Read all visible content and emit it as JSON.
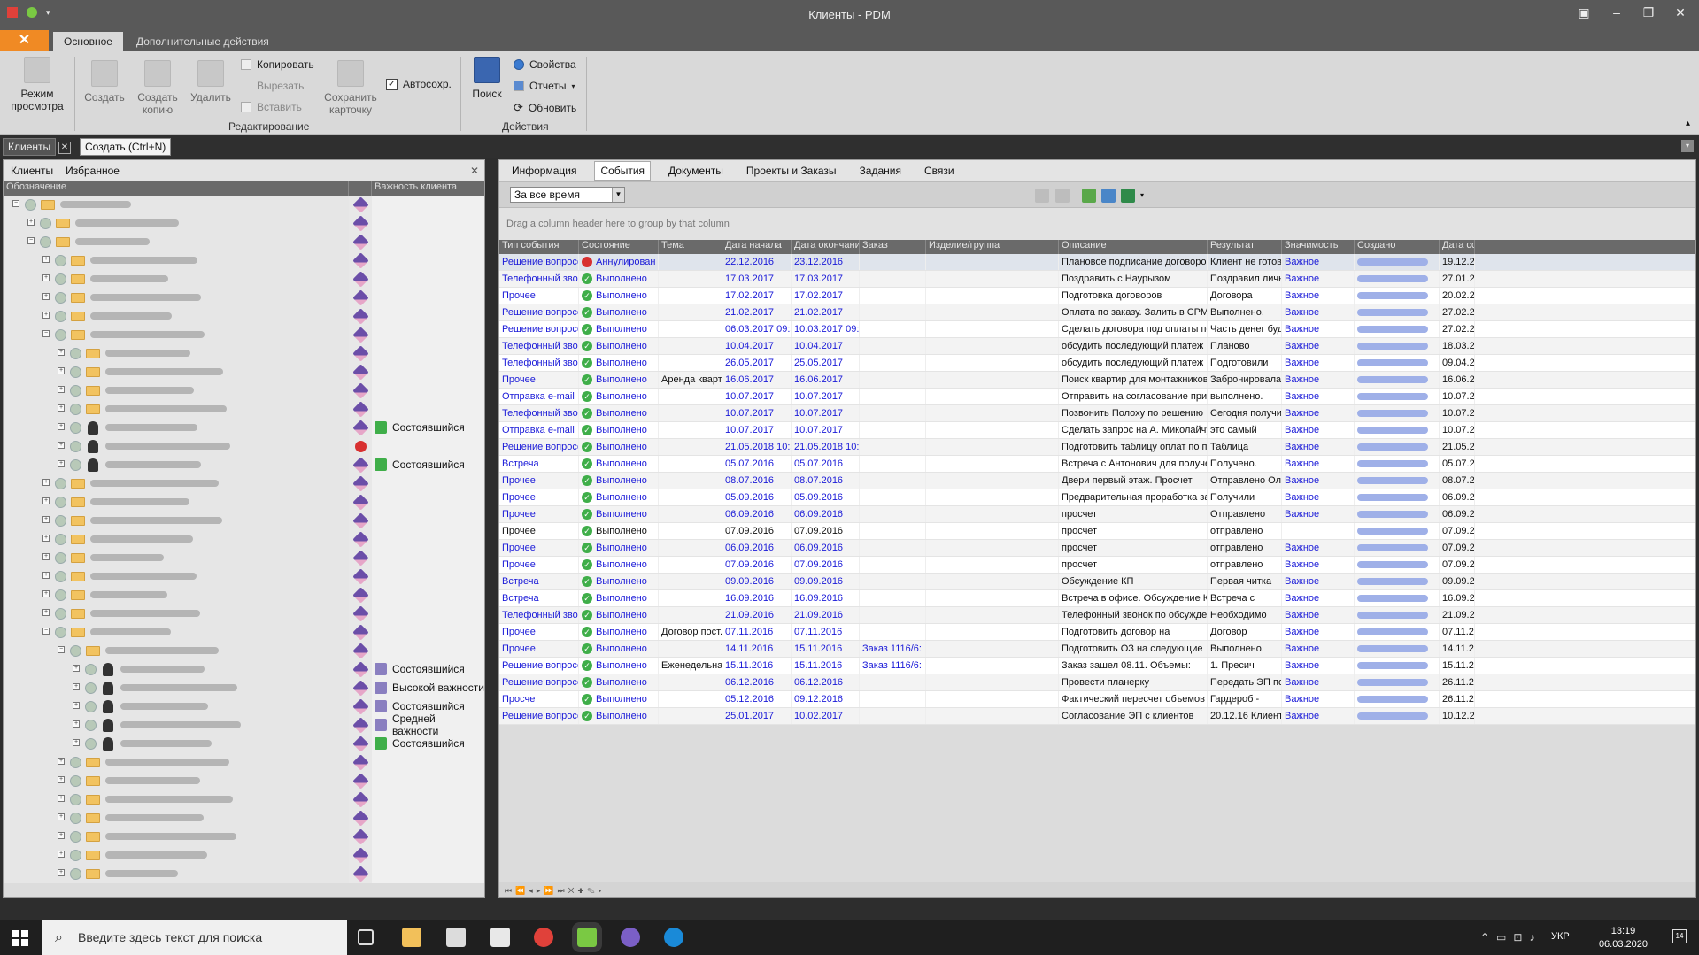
{
  "window": {
    "title": "Клиенты - PDM"
  },
  "ribbon": {
    "tabs": [
      "Основное",
      "Дополнительные действия"
    ],
    "view_mode": "Режим просмотра",
    "create": "Создать",
    "create_copy": "Создать копию",
    "delete": "Удалить",
    "copy": "Копировать",
    "cut": "Вырезать",
    "paste": "Вставить",
    "save_card": "Сохранить карточку",
    "autosave": "Автосохр.",
    "search": "Поиск",
    "properties": "Свойства",
    "reports": "Отчеты",
    "refresh": "Обновить",
    "group_edit": "Редактирование",
    "group_actions": "Действия"
  },
  "doc_tabs": {
    "clients": "Клиенты",
    "create": "Создать (Ctrl+N)"
  },
  "left_panel": {
    "tabs": [
      "Клиенты",
      "Избранное"
    ],
    "col_name": "Обозначение",
    "col_importance": "Важность клиента",
    "rows": [
      {
        "lvl": 0,
        "exp": "-",
        "icon": "folder",
        "imp": ""
      },
      {
        "lvl": 1,
        "exp": "+",
        "icon": "folder",
        "imp": ""
      },
      {
        "lvl": 1,
        "exp": "-",
        "icon": "folder",
        "imp": ""
      },
      {
        "lvl": 2,
        "exp": "+",
        "icon": "folder",
        "imp": ""
      },
      {
        "lvl": 2,
        "exp": "+",
        "icon": "folder",
        "imp": ""
      },
      {
        "lvl": 2,
        "exp": "+",
        "icon": "folder",
        "imp": ""
      },
      {
        "lvl": 2,
        "exp": "+",
        "icon": "folder",
        "imp": ""
      },
      {
        "lvl": 2,
        "exp": "-",
        "icon": "folder",
        "imp": ""
      },
      {
        "lvl": 3,
        "exp": "+",
        "icon": "folder",
        "imp": ""
      },
      {
        "lvl": 3,
        "exp": "+",
        "icon": "folder",
        "imp": ""
      },
      {
        "lvl": 3,
        "exp": "+",
        "icon": "folder",
        "imp": ""
      },
      {
        "lvl": 3,
        "exp": "+",
        "icon": "folder",
        "imp": ""
      },
      {
        "lvl": 3,
        "exp": "+",
        "icon": "person",
        "imp": "Состоявшийся",
        "impc": "#3fae49"
      },
      {
        "lvl": 3,
        "exp": "+",
        "icon": "person",
        "imp": "",
        "blocked": true
      },
      {
        "lvl": 3,
        "exp": "+",
        "icon": "person",
        "imp": "Состоявшийся",
        "impc": "#3fae49"
      },
      {
        "lvl": 2,
        "exp": "+",
        "icon": "folder",
        "imp": ""
      },
      {
        "lvl": 2,
        "exp": "+",
        "icon": "folder",
        "imp": ""
      },
      {
        "lvl": 2,
        "exp": "+",
        "icon": "folder",
        "imp": ""
      },
      {
        "lvl": 2,
        "exp": "+",
        "icon": "folder",
        "imp": ""
      },
      {
        "lvl": 2,
        "exp": "+",
        "icon": "folder",
        "imp": ""
      },
      {
        "lvl": 2,
        "exp": "+",
        "icon": "folder",
        "imp": ""
      },
      {
        "lvl": 2,
        "exp": "+",
        "icon": "folder",
        "imp": ""
      },
      {
        "lvl": 2,
        "exp": "+",
        "icon": "folder",
        "imp": ""
      },
      {
        "lvl": 2,
        "exp": "-",
        "icon": "folder",
        "imp": ""
      },
      {
        "lvl": 3,
        "exp": "-",
        "icon": "folder",
        "imp": ""
      },
      {
        "lvl": 4,
        "exp": "+",
        "icon": "person",
        "imp": "Состоявшийся",
        "impc": "#8a7fc0"
      },
      {
        "lvl": 4,
        "exp": "+",
        "icon": "person",
        "imp": "Высокой важности",
        "impc": "#8a7fc0"
      },
      {
        "lvl": 4,
        "exp": "+",
        "icon": "person",
        "imp": "Состоявшийся",
        "impc": "#8a7fc0"
      },
      {
        "lvl": 4,
        "exp": "+",
        "icon": "person",
        "imp": "Средней важности",
        "impc": "#8a7fc0"
      },
      {
        "lvl": 4,
        "exp": "+",
        "icon": "person",
        "imp": "Состоявшийся",
        "impc": "#3fae49"
      },
      {
        "lvl": 3,
        "exp": "+",
        "icon": "folder",
        "imp": ""
      },
      {
        "lvl": 3,
        "exp": "+",
        "icon": "folder",
        "imp": ""
      },
      {
        "lvl": 3,
        "exp": "+",
        "icon": "folder",
        "imp": ""
      },
      {
        "lvl": 3,
        "exp": "+",
        "icon": "folder",
        "imp": ""
      },
      {
        "lvl": 3,
        "exp": "+",
        "icon": "folder",
        "imp": ""
      },
      {
        "lvl": 3,
        "exp": "+",
        "icon": "folder",
        "imp": ""
      },
      {
        "lvl": 3,
        "exp": "+",
        "icon": "folder",
        "imp": ""
      }
    ]
  },
  "right_panel": {
    "tabs": [
      "Информация",
      "События",
      "Документы",
      "Проекты и Заказы",
      "Задания",
      "Связи"
    ],
    "period": "За все время",
    "group_hint": "Drag a column header here to group by that column",
    "columns": [
      "Тип события",
      "Состояние",
      "Тема",
      "Дата начала",
      "Дата окончания",
      "Заказ",
      "Изделие/группа",
      "Описание",
      "Результат",
      "Значимость",
      "Создано",
      "Дата соз"
    ],
    "rows": [
      [
        "Решение вопросов",
        "Аннулирован",
        "",
        "22.12.2016",
        "23.12.2016",
        "",
        "",
        "Плановое подписание договоров",
        "Клиент не  готов",
        "Важное",
        "",
        "19.12.2"
      ],
      [
        "Телефонный звонок",
        "Выполнено",
        "",
        "17.03.2017",
        "17.03.2017",
        "",
        "",
        "Поздравить с Наурызом",
        "Поздравил лично",
        "Важное",
        "",
        "27.01.2"
      ],
      [
        "Прочее",
        "Выполнено",
        "",
        "17.02.2017",
        "17.02.2017",
        "",
        "",
        "Подготовка договоров",
        "Договора",
        "Важное",
        "",
        "20.02.2"
      ],
      [
        "Решение вопросов",
        "Выполнено",
        "",
        "21.02.2017",
        "21.02.2017",
        "",
        "",
        "Оплата по заказу. Залить в CPM.",
        "Выполнено.",
        "Важное",
        "",
        "27.02.2"
      ],
      [
        "Решение вопросов",
        "Выполнено",
        "",
        "06.03.2017 09:5...",
        "10.03.2017 09:5...",
        "",
        "",
        "Сделать договора под оплаты по",
        "Часть денег будем",
        "Важное",
        "",
        "27.02.2"
      ],
      [
        "Телефонный звонок",
        "Выполнено",
        "",
        "10.04.2017",
        "10.04.2017",
        "",
        "",
        "обсудить последующий платеж",
        "Планово",
        "Важное",
        "",
        "18.03.2"
      ],
      [
        "Телефонный звонок",
        "Выполнено",
        "",
        "26.05.2017",
        "25.05.2017",
        "",
        "",
        "обсудить последующий платеж",
        "Подготовили",
        "Важное",
        "",
        "09.04.2"
      ],
      [
        "Прочее",
        "Выполнено",
        "Аренда кварти...",
        "16.06.2017",
        "16.06.2017",
        "",
        "",
        "Поиск квартир  для монтажников на",
        "Забронировала 2-х",
        "Важное",
        "",
        "16.06.2"
      ],
      [
        "Отправка e-mail",
        "Выполнено",
        "",
        "10.07.2017",
        "10.07.2017",
        "",
        "",
        "Отправить на согласование пример",
        "выполнено.",
        "Важное",
        "",
        "10.07.2"
      ],
      [
        "Телефонный звонок",
        "Выполнено",
        "",
        "10.07.2017",
        "10.07.2017",
        "",
        "",
        "Позвонить Полоху по решению",
        "Сегодня получили",
        "Важное",
        "",
        "10.07.2"
      ],
      [
        "Отправка e-mail",
        "Выполнено",
        "",
        "10.07.2017",
        "10.07.2017",
        "",
        "",
        "Сделать запрос на А. Миколайчук на",
        "это самый",
        "Важное",
        "",
        "10.07.2"
      ],
      [
        "Решение вопросов",
        "Выполнено",
        "",
        "21.05.2018 10:5...",
        "21.05.2018 10:5...",
        "",
        "",
        "Подготовить таблицу оплат по проекту",
        "Таблица",
        "Важное",
        "",
        "21.05.2"
      ],
      [
        "Встреча",
        "Выполнено",
        "",
        "05.07.2016",
        "05.07.2016",
        "",
        "",
        "Встреча с Антонович для получения",
        "Получено.",
        "Важное",
        "",
        "05.07.2"
      ],
      [
        "Прочее",
        "Выполнено",
        "",
        "08.07.2016",
        "08.07.2016",
        "",
        "",
        "Двери первый этаж. Просчет",
        "Отправлено Олегу",
        "Важное",
        "",
        "08.07.2"
      ],
      [
        "Прочее",
        "Выполнено",
        "",
        "05.09.2016",
        "05.09.2016",
        "",
        "",
        "Предварительная проработка заказа",
        "Получили",
        "Важное",
        "",
        "06.09.2"
      ],
      [
        "Прочее",
        "Выполнено",
        "",
        "06.09.2016",
        "06.09.2016",
        "",
        "",
        "просчет",
        "Отправлено",
        "Важное",
        "",
        "06.09.2"
      ],
      [
        "Прочее",
        "Выполнено",
        "",
        "07.09.2016",
        "07.09.2016",
        "",
        "",
        "просчет",
        "отправлено",
        "",
        "",
        "07.09.2"
      ],
      [
        "Прочее",
        "Выполнено",
        "",
        "06.09.2016",
        "06.09.2016",
        "",
        "",
        "просчет",
        "отправлено",
        "Важное",
        "",
        "07.09.2"
      ],
      [
        "Прочее",
        "Выполнено",
        "",
        "07.09.2016",
        "07.09.2016",
        "",
        "",
        "просчет",
        "отправлено",
        "Важное",
        "",
        "07.09.2"
      ],
      [
        "Встреча",
        "Выполнено",
        "",
        "09.09.2016",
        "09.09.2016",
        "",
        "",
        "Обсуждение КП",
        "Первая читка",
        "Важное",
        "",
        "09.09.2"
      ],
      [
        "Встреча",
        "Выполнено",
        "",
        "16.09.2016",
        "16.09.2016",
        "",
        "",
        "Встреча в офисе. Обсуждение КП",
        "Встреча с",
        "Важное",
        "",
        "16.09.2"
      ],
      [
        "Телефонный звонок",
        "Выполнено",
        "",
        "21.09.2016",
        "21.09.2016",
        "",
        "",
        "Телефонный звонок по обсуждению",
        "Необходимо",
        "Важное",
        "",
        "21.09.2"
      ],
      [
        "Прочее",
        "Выполнено",
        "Договор пост...",
        "07.11.2016",
        "07.11.2016",
        "",
        "",
        "Подготовить договор на",
        "Договор",
        "Важное",
        "",
        "07.11.2"
      ],
      [
        "Прочее",
        "Выполнено",
        "",
        "14.11.2016",
        "15.11.2016",
        "Заказ 1116/6: ...",
        "",
        "Подготовить ОЗ на следующие",
        "Выполнено.",
        "Важное",
        "",
        "14.11.2"
      ],
      [
        "Решение вопросов",
        "Выполнено",
        "Еженедельная...",
        "15.11.2016",
        "15.11.2016",
        "Заказ 1116/6: ...",
        "",
        "Заказ зашел 08.11. Объемы:",
        "1. Пресич",
        "Важное",
        "",
        "15.11.2"
      ],
      [
        "Решение вопросов",
        "Выполнено",
        "",
        "06.12.2016",
        "06.12.2016",
        "",
        "",
        "Провести планерку",
        "Передать ЭП по",
        "Важное",
        "",
        "26.11.2"
      ],
      [
        "Просчет",
        "Выполнено",
        "",
        "05.12.2016",
        "09.12.2016",
        "",
        "",
        "Фактический пересчет объемов",
        "Гардероб -",
        "Важное",
        "",
        "26.11.2"
      ],
      [
        "Решение вопросов",
        "Выполнено",
        "",
        "25.01.2017",
        "10.02.2017",
        "",
        "",
        "Согласование ЭП с клиентов",
        "20.12.16 Клиент",
        "Важное",
        "",
        "10.12.2"
      ]
    ]
  },
  "taskbar": {
    "search_placeholder": "Введите здесь текст для поиска",
    "lang": "УКР",
    "time": "13:19",
    "date": "06.03.2020",
    "notif": "14"
  },
  "colors": {
    "accent": "#f08a24",
    "link": "#1a1ad8",
    "ok": "#3fae49",
    "cancel": "#d83030"
  }
}
